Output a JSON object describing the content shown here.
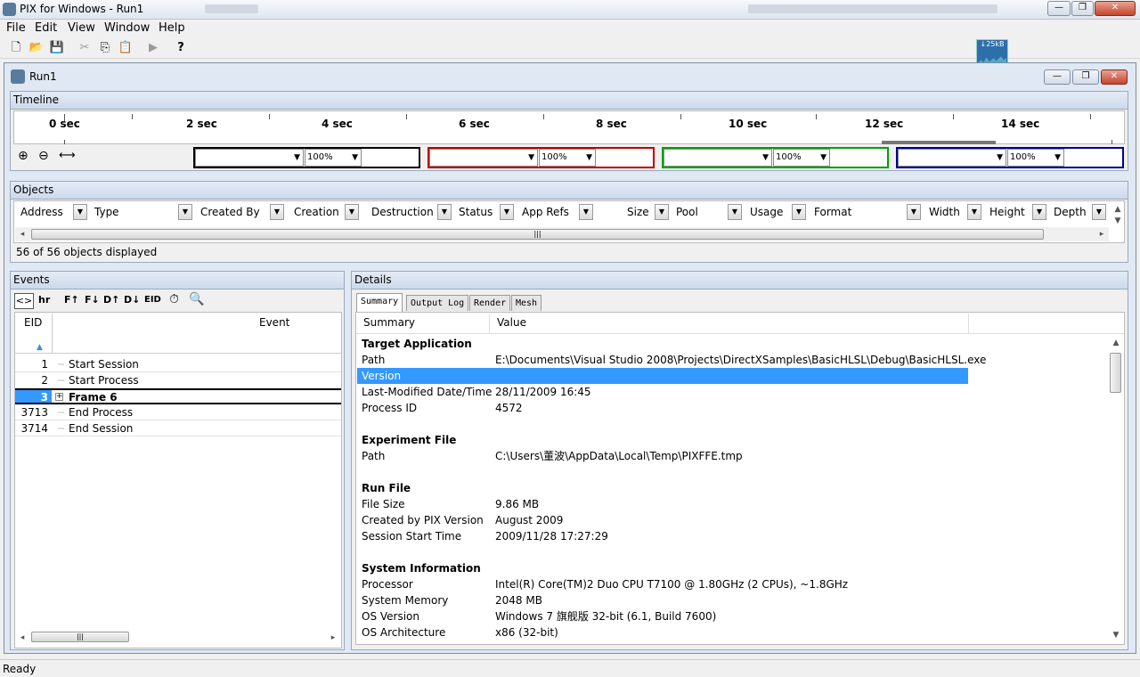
{
  "window": {
    "title": "PIX for Windows - Run1"
  },
  "menu": {
    "items": [
      "File",
      "Edit",
      "View",
      "Window",
      "Help"
    ]
  },
  "network_widget": {
    "label": "↓25kB"
  },
  "run_window": {
    "title": "Run1"
  },
  "timeline": {
    "header": "Timeline",
    "ticks": [
      "0 sec",
      "2 sec",
      "4 sec",
      "6 sec",
      "8 sec",
      "10 sec",
      "12 sec",
      "14 sec"
    ],
    "zooms": [
      "100%",
      "100%",
      "100%",
      "100%"
    ]
  },
  "objects": {
    "header": "Objects",
    "columns": [
      "Address",
      "Type",
      "Created By",
      "Creation",
      "Destruction",
      "Status",
      "App Refs",
      "Size",
      "Pool",
      "Usage",
      "Format",
      "Width",
      "Height",
      "Depth"
    ],
    "footer": "56 of 56 objects displayed"
  },
  "events": {
    "header": "Events",
    "toolbar": [
      "<>",
      "hr",
      "F↑",
      "F↓",
      "D↑",
      "D↓",
      "EID"
    ],
    "col_eid": "EID",
    "col_event": "Event",
    "rows": [
      {
        "eid": "1",
        "name": "Start Session"
      },
      {
        "eid": "2",
        "name": "Start Process"
      },
      {
        "eid": "3",
        "name": "Frame 6"
      },
      {
        "eid": "3713",
        "name": "End Process"
      },
      {
        "eid": "3714",
        "name": "End Session"
      }
    ]
  },
  "details": {
    "header": "Details",
    "tabs": [
      "Summary",
      "Output Log",
      "Render",
      "Mesh"
    ],
    "col_summary": "Summary",
    "col_value": "Value",
    "sections": [
      {
        "title": "Target Application",
        "rows": [
          {
            "k": "Path",
            "v": "E:\\Documents\\Visual Studio 2008\\Projects\\DirectXSamples\\BasicHLSL\\Debug\\BasicHLSL.exe"
          },
          {
            "k": "Version",
            "v": ""
          },
          {
            "k": "Last-Modified Date/Time",
            "v": "28/11/2009  16:45"
          },
          {
            "k": "Process ID",
            "v": "4572"
          }
        ]
      },
      {
        "title": "Experiment File",
        "rows": [
          {
            "k": "Path",
            "v": "C:\\Users\\董波\\AppData\\Local\\Temp\\PIXFFE.tmp"
          }
        ]
      },
      {
        "title": "Run File",
        "rows": [
          {
            "k": "File Size",
            "v": "9.86 MB"
          },
          {
            "k": "Created by PIX Version",
            "v": "August 2009"
          },
          {
            "k": "Session Start Time",
            "v": "2009/11/28 17:27:29"
          }
        ]
      },
      {
        "title": "System Information",
        "rows": [
          {
            "k": "Processor",
            "v": "Intel(R) Core(TM)2 Duo CPU     T7100  @ 1.80GHz (2 CPUs), ~1.8GHz"
          },
          {
            "k": "System Memory",
            "v": "2048 MB"
          },
          {
            "k": "OS Version",
            "v": "Windows 7 旗舰版 32-bit (6.1, Build 7600)"
          },
          {
            "k": "OS Architecture",
            "v": "x86 (32-bit)"
          }
        ]
      }
    ]
  },
  "statusbar": {
    "text": "Ready"
  },
  "colors": {
    "selection": "#3399ff",
    "panel_header": "#cdd9ea",
    "track_black": "#000000",
    "track_red": "#c00000",
    "track_green": "#00a000",
    "track_blue": "#000090"
  }
}
